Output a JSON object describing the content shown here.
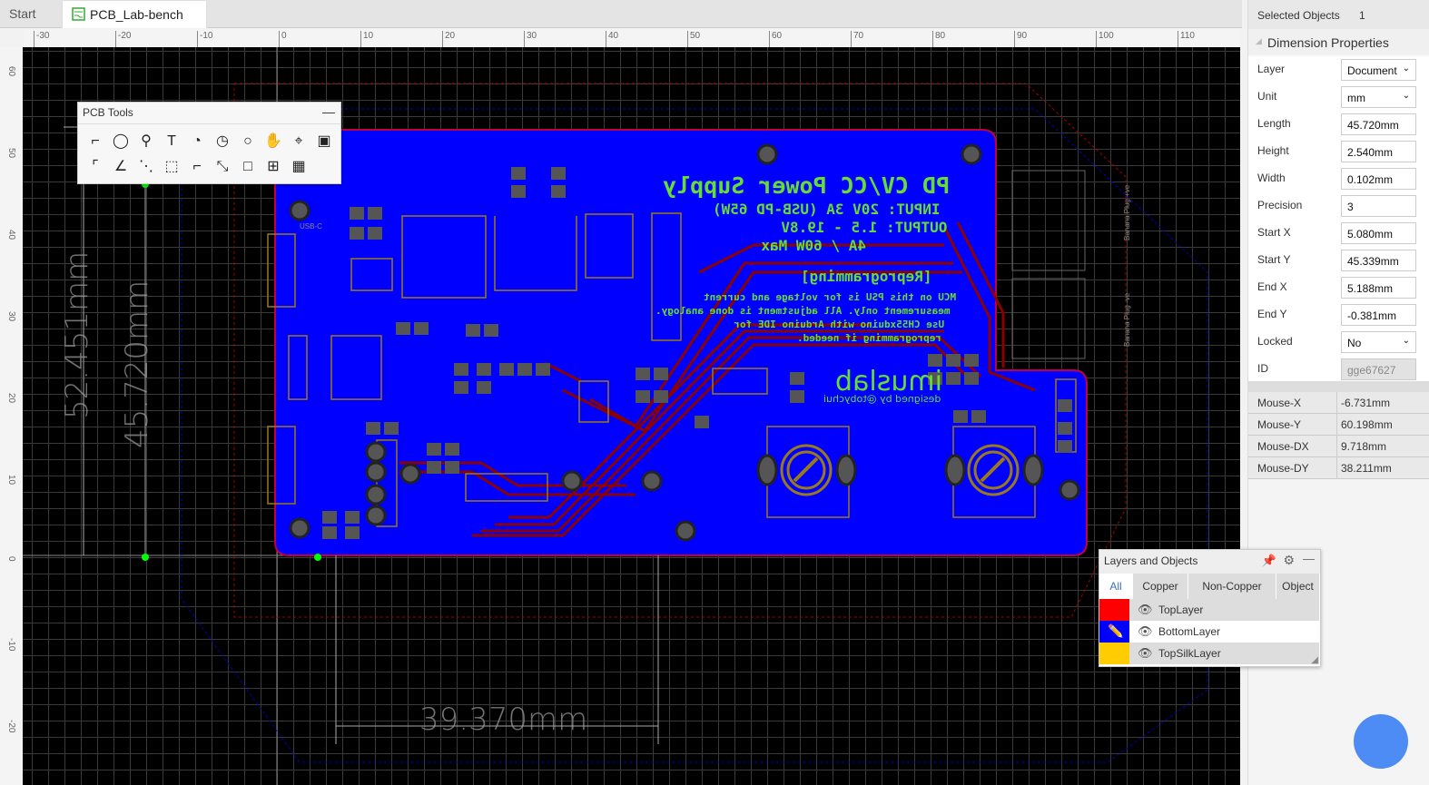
{
  "tabs": [
    {
      "label": "Start"
    },
    {
      "label": "PCB_Lab-bench ..."
    }
  ],
  "ruler": {
    "x_labels": [
      "-30",
      "-20",
      "-10",
      "0",
      "10",
      "20",
      "30",
      "40",
      "50",
      "60",
      "70",
      "80",
      "90",
      "100",
      "110"
    ],
    "y_labels": [
      "60",
      "50",
      "40",
      "30",
      "20",
      "10",
      "0",
      "-10",
      "-20"
    ]
  },
  "pcb_tools": {
    "title": "PCB Tools",
    "tools_row1": [
      "track",
      "via",
      "pad",
      "text",
      "arc",
      "arc-center",
      "circle",
      "pan",
      "hole",
      "image"
    ],
    "tools_row2": [
      "dimension",
      "angle",
      "connect",
      "solid-region",
      "copper-area",
      "measure",
      "rectangle",
      "group",
      "table"
    ]
  },
  "board_text": {
    "title": "PD CV/CC Power Supply",
    "input": "INPUT: 20V 3A (USB-PD 65W)",
    "output": "OUTPUT: 1.5 - 19.8V",
    "max": "4A / 60W Max",
    "reprog": "[Reprogramming]",
    "note1": "MCU on this PSU is for voltage and current",
    "note2": "measurement only. All adjustment is done analogy.",
    "note3": "Use CH55xduino with Arduino IDE for",
    "note4": "reprogramming if needed.",
    "brand": "imuslab",
    "designer": "designed by @tobychui",
    "banana_pos": "Banana Plug +ve",
    "banana_neg": "Banana Plug -ve",
    "usbc": "USB-C"
  },
  "dimensions": {
    "d1": "52.451mm",
    "d2": "45.720mm",
    "d3": "39.370mm"
  },
  "properties": {
    "selected_label": "Selected Objects",
    "selected_count": "1",
    "section": "Dimension Properties",
    "rows": [
      {
        "label": "Layer",
        "value": "Document",
        "dropdown": true
      },
      {
        "label": "Unit",
        "value": "mm",
        "dropdown": true
      },
      {
        "label": "Length",
        "value": "45.720mm"
      },
      {
        "label": "Height",
        "value": "2.540mm"
      },
      {
        "label": "Width",
        "value": "0.102mm"
      },
      {
        "label": "Precision",
        "value": "3"
      },
      {
        "label": "Start X",
        "value": "5.080mm"
      },
      {
        "label": "Start Y",
        "value": "45.339mm"
      },
      {
        "label": "End X",
        "value": "5.188mm"
      },
      {
        "label": "End Y",
        "value": "-0.381mm"
      },
      {
        "label": "Locked",
        "value": "No",
        "dropdown": true
      },
      {
        "label": "ID",
        "value": "gge67627",
        "disabled": true
      }
    ],
    "mouse": [
      {
        "label": "Mouse-X",
        "value": "-6.731mm"
      },
      {
        "label": "Mouse-Y",
        "value": "60.198mm"
      },
      {
        "label": "Mouse-DX",
        "value": "9.718mm"
      },
      {
        "label": "Mouse-DY",
        "value": "38.211mm"
      }
    ]
  },
  "layers": {
    "title": "Layers and Objects",
    "tabs": [
      "All",
      "Copper",
      "Non-Copper",
      "Object"
    ],
    "items": [
      {
        "name": "TopLayer",
        "color": "#ff0000"
      },
      {
        "name": "BottomLayer",
        "color": "#0000ff",
        "active": true
      },
      {
        "name": "TopSilkLayer",
        "color": "#ffcc00"
      }
    ]
  },
  "colors": {
    "board": "#0000ff",
    "silk_text": "#66dd33",
    "accent": "#4d8cf5"
  }
}
